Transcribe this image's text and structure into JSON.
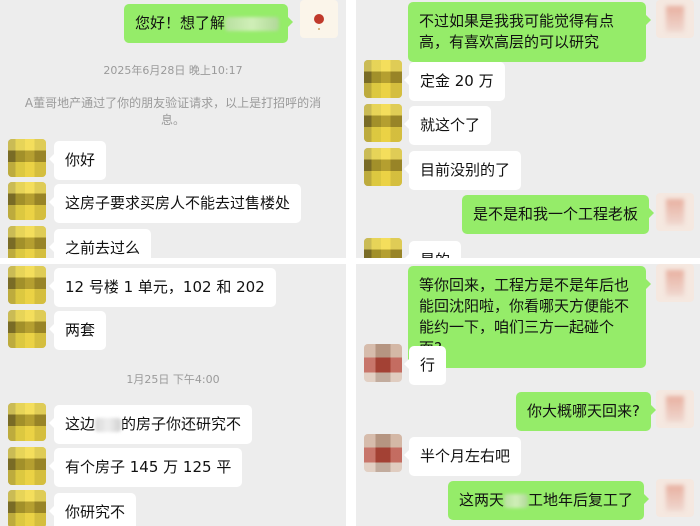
{
  "panel1": {
    "greeting_pre": "您好！想了解",
    "timestamp": "2025年6月28日 晚上10:17",
    "system_notice": "A董哥地产通过了你的朋友验证请求，以上是打招呼的消息。",
    "msg_hello": "你好",
    "msg_requirement": "这房子要求买房人不能去过售楼处",
    "msg_visited": "之前去过么"
  },
  "panel2": {
    "msg_unit": "12 号楼 1 单元，102 和 202",
    "msg_two": "两套",
    "timestamp": "1月25日 下午4:00",
    "msg_research_pre": "这边",
    "msg_research_post": "的房子你还研究不",
    "msg_price": "有个房子 145 万  125 平",
    "msg_study": "你研究不"
  },
  "panel3": {
    "msg_high_floor": "不过如果是我我可能觉得有点高，有喜欢高层的可以研究",
    "msg_deposit": "定金 20 万",
    "msg_that": "就这个了",
    "msg_none": "目前没别的了",
    "msg_boss": "是不是和我一个工程老板",
    "msg_yes_partial": "是的"
  },
  "panel4": {
    "msg_meet": "等你回来，工程方是不是年后也能回沈阳啦，你看哪天方便能不能约一下，咱们三方一起碰个面?",
    "msg_ok": "行",
    "msg_when": "你大概哪天回来?",
    "msg_half_month": "半个月左右吧",
    "msg_resume_pre": "这两天",
    "msg_resume_post": "工地年后复工了"
  },
  "colors": {
    "chat_bg": "#ededed",
    "outgoing_bubble": "#95ec69",
    "incoming_bubble": "#ffffff",
    "meta_text": "#9a9a9a"
  }
}
